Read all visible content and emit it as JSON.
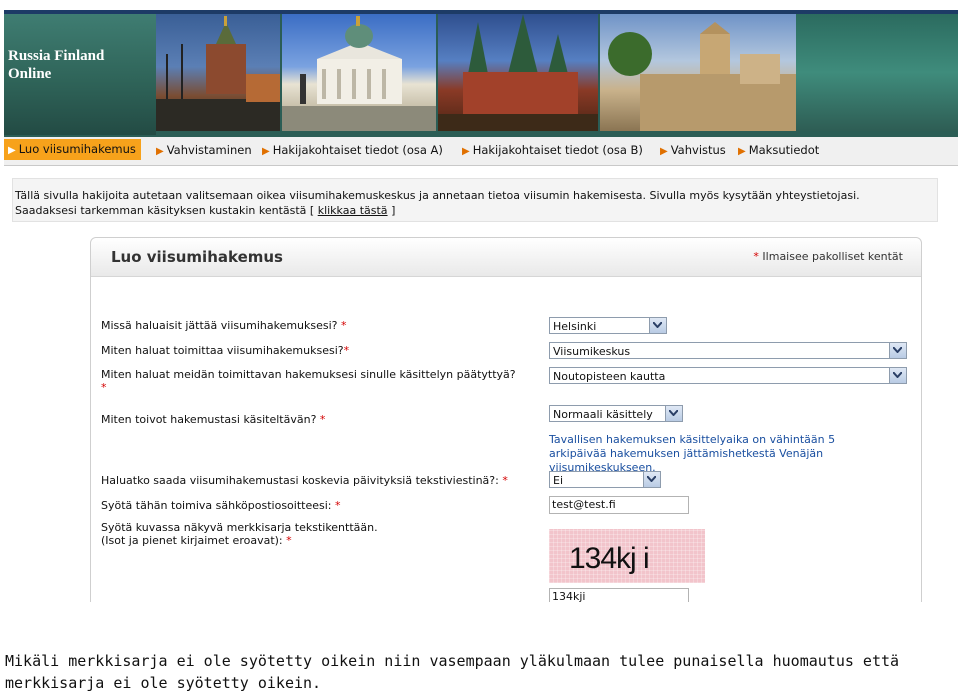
{
  "banner": {
    "brand_text": "Russia Finland\nOnline"
  },
  "nav": {
    "items": [
      {
        "label": "Luo viisumihakemus",
        "active": true
      },
      {
        "label": "Vahvistaminen"
      },
      {
        "label": "Hakijakohtaiset tiedot (osa A)"
      },
      {
        "label": "Hakijakohtaiset tiedot (osa B)"
      },
      {
        "label": "Vahvistus"
      },
      {
        "label": "Maksutiedot"
      }
    ]
  },
  "intro": {
    "line1": "Tällä sivulla hakijoita autetaan valitsemaan oikea viisumihakemuskeskus ja annetaan tietoa viisumin hakemisesta. Sivulla myös kysytään yhteystietojasi.",
    "line2_prefix": "Saadaksesi tarkemman käsityksen kustakin kentästä [",
    "link": "klikkaa tästä",
    "line2_suffix": "]"
  },
  "form": {
    "title": "Luo viisumihakemus",
    "required_note": "Ilmaisee pakolliset kentät",
    "required_mark": "*",
    "q1_label": "Missä haluaisit jättää viisumihakemuksesi?",
    "q1_value": "Helsinki",
    "q2_label": "Miten haluat toimittaa viisumihakemuksesi?",
    "q2_value": "Viisumikeskus",
    "q3_label": "Miten haluat meidän toimittavan hakemuksesi sinulle käsittelyn päätyttyä?",
    "q3_value": "Noutopisteen kautta",
    "q4_label": "Miten toivot hakemustasi käsiteltävän?",
    "q4_value": "Normaali käsittely",
    "q4_hint": "Tavallisen hakemuksen käsittelyaika on vähintään 5 arkipäivää hakemuksen jättämishetkestä Venäjän viisumikeskukseen.",
    "q5_label": "Haluatko saada viisumihakemustasi koskevia päivityksiä tekstiviestinä?:",
    "q5_value": "Ei",
    "q6_label": "Syötä tähän toimiva sähköpostiosoitteesi:",
    "q6_value": "test@test.fi",
    "q7_label_line1": "Syötä kuvassa näkyvä merkkisarja tekstikenttään.",
    "q7_label_line2": "(Isot ja pienet kirjaimet eroavat):",
    "captcha_text": "134kj i",
    "captcha_value": "134kji"
  },
  "caption": "Mikäli merkkisarja ei ole syötetty oikein niin vasempaan yläkulmaan tulee punaisella huomautus että merkkisarja ei ole syötetty oikein.",
  "colors": {
    "banner": "#2b5d55",
    "nav_active": "#f7a21b",
    "nav_arrow": "#e07000",
    "required": "#d40000",
    "hint": "#1a4fa0"
  }
}
